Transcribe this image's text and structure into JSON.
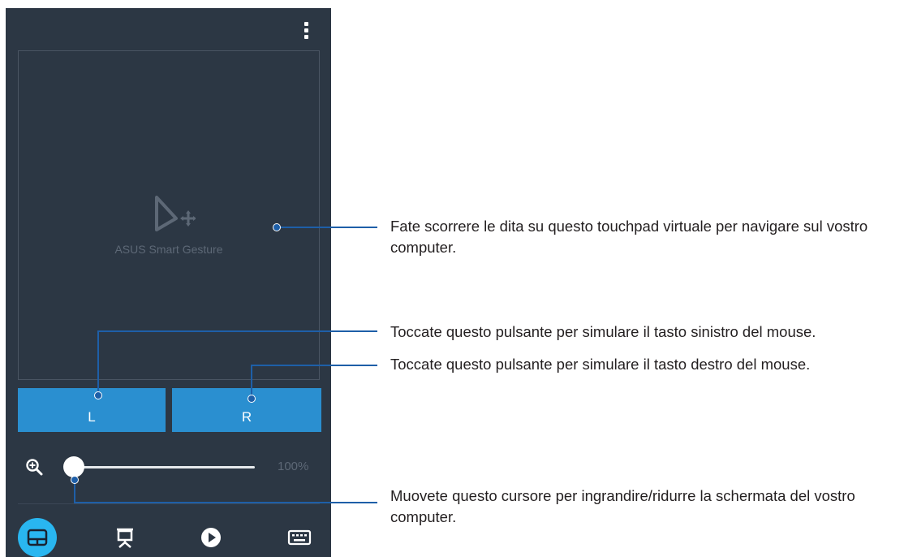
{
  "touchpad": {
    "label": "ASUS Smart Gesture"
  },
  "buttons": {
    "left": "L",
    "right": "R"
  },
  "zoom": {
    "value_label": "100%",
    "level": 0.0
  },
  "toolbar": {
    "icons": [
      "more-vert-icon"
    ],
    "nav": [
      "touchpad-icon",
      "presentation-icon",
      "play-icon",
      "keyboard-icon"
    ],
    "active_nav": "touchpad-icon"
  },
  "callouts": {
    "touchpad": "Fate scorrere le dita su questo touchpad virtuale per navigare sul vostro computer.",
    "left_button": "Toccate questo pulsante per simulare il tasto sinistro del mouse.",
    "right_button": "Toccate questo pulsante per simulare il tasto destro del mouse.",
    "slider": "Muovete questo cursore per ingrandire/ridurre la schermata del vostro computer."
  },
  "colors": {
    "phone_bg": "#2c3744",
    "button_blue": "#2a8fd0",
    "active_nav": "#29b6f0",
    "callout_line": "#1e5fa8"
  }
}
